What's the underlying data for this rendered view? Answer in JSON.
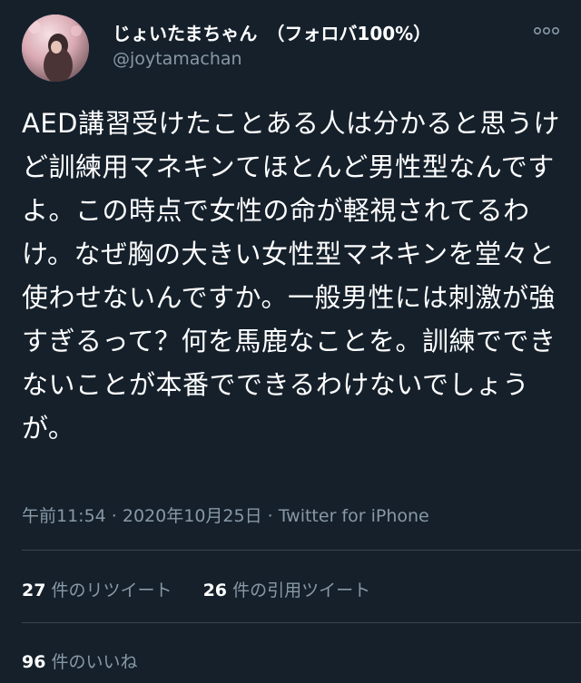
{
  "author": {
    "display_name": "じょいたまちゃん　（フォロバ100%）",
    "handle": "@joytamachan"
  },
  "tweet": {
    "text": "AED講習受けたことある人は分かると思うけど訓練用マネキンてほとんど男性型なんですよ。この時点で女性の命が軽視されてるわけ。なぜ胸の大きい女性型マネキンを堂々と使わせないんですか。一般男性には刺激が強すぎるって？何を馬鹿なことを。訓練でできないことが本番でできるわけないでしょうが。",
    "timestamp": "午前11:54 · 2020年10月25日 · ",
    "source": "Twitter for iPhone"
  },
  "stats": {
    "retweets_count": "27",
    "retweets_label": "件のリツイート",
    "quotes_count": "26",
    "quotes_label": "件の引用ツイート",
    "likes_count": "96",
    "likes_label": "件のいいね"
  },
  "icons": {
    "more": "more-options-icon",
    "avatar": "profile-avatar"
  },
  "colors": {
    "background": "#15202b",
    "text_primary": "#ffffff",
    "text_secondary": "#8899a6",
    "divider": "#38444d"
  }
}
